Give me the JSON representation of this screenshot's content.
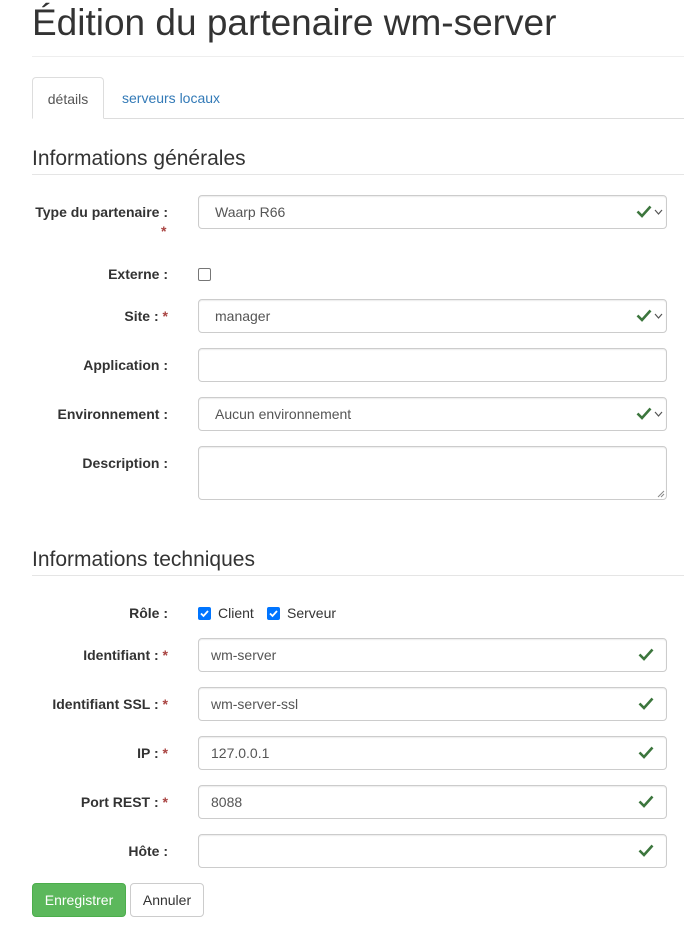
{
  "page": {
    "title": "Édition du partenaire wm-server"
  },
  "tabs": [
    {
      "label": "détails",
      "active": true
    },
    {
      "label": "serveurs locaux",
      "active": false
    }
  ],
  "sections": {
    "general": "Informations générales",
    "technical": "Informations techniques"
  },
  "required_marker": "*",
  "form": {
    "partner_type": {
      "label": "Type du partenaire :",
      "value": "Waarp R66",
      "required": true
    },
    "external": {
      "label": "Externe :",
      "checked": false
    },
    "site": {
      "label": "Site :",
      "value": "manager",
      "required": true
    },
    "application": {
      "label": "Application :",
      "value": ""
    },
    "environment": {
      "label": "Environnement :",
      "value": "Aucun environnement"
    },
    "description": {
      "label": "Description :",
      "value": ""
    },
    "role": {
      "label": "Rôle :",
      "options": [
        {
          "label": "Client",
          "checked": true
        },
        {
          "label": "Serveur",
          "checked": true
        }
      ]
    },
    "identifier": {
      "label": "Identifiant :",
      "value": "wm-server",
      "required": true
    },
    "ssl_identifier": {
      "label": "Identifiant SSL :",
      "value": "wm-server-ssl",
      "required": true
    },
    "ip": {
      "label": "IP :",
      "value": "127.0.0.1",
      "required": true
    },
    "rest_port": {
      "label": "Port REST :",
      "value": "8088",
      "required": true
    },
    "host": {
      "label": "Hôte :",
      "value": ""
    }
  },
  "buttons": {
    "save": "Enregistrer",
    "cancel": "Annuler"
  },
  "colors": {
    "valid_check": "#3c763d",
    "link": "#337ab7",
    "required": "#a94442",
    "save_button": "#5cb85c",
    "checkbox_checked": "#0075ff"
  }
}
